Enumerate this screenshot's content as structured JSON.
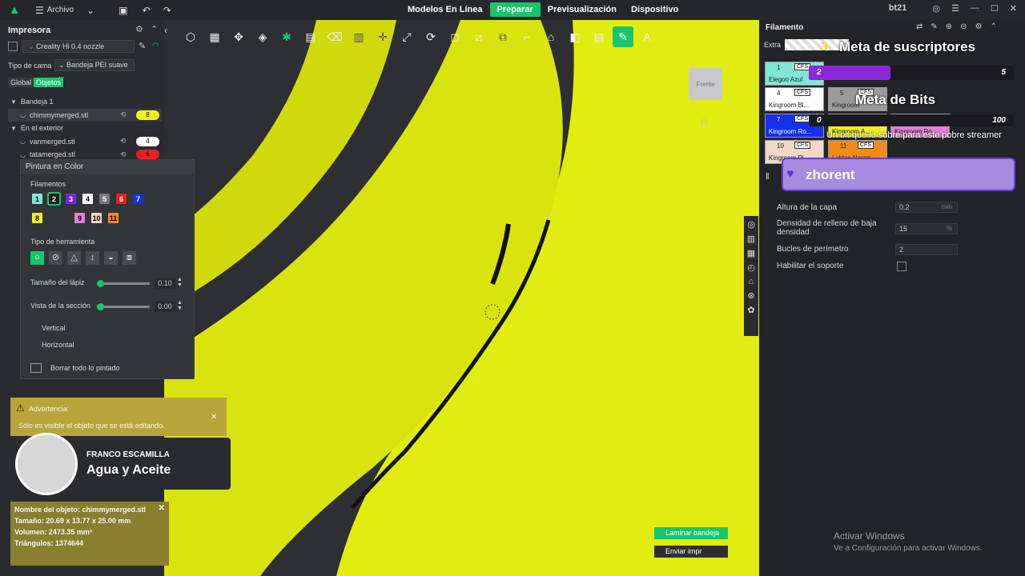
{
  "topbar": {
    "file_label": "Archivo",
    "tabs": [
      "Modelos En Línea",
      "Preparar",
      "Previsualización",
      "Dispositivo"
    ],
    "active_tab": "Preparar",
    "user": "bt21"
  },
  "left": {
    "printer_title": "Impresora",
    "printer_name": "Creality Hi 0.4 nozzle",
    "bed_label": "Tipo de cama",
    "bed_value": "Bandeja PEI suave ...",
    "mode_tabs": [
      "Global",
      "Objetos"
    ],
    "tree": [
      {
        "label": "Bandeja 1",
        "level": 0
      },
      {
        "label": "chimmymerged.stl",
        "level": 1,
        "badge": "8",
        "badge_color": "#f2f21a"
      },
      {
        "label": "En el exterior",
        "level": 0
      },
      {
        "label": "vanmerged.stl",
        "level": 1,
        "badge": "4",
        "badge_color": "#ffffff"
      },
      {
        "label": "tatamerged.stl",
        "level": 1,
        "badge": "6",
        "badge_color": "#e8201e"
      }
    ]
  },
  "paint": {
    "title": "Pintura en Color",
    "filaments_label": "Filamentos",
    "filaments": [
      {
        "n": "1",
        "color": "#7fe7d6"
      },
      {
        "n": "2",
        "color": "#1a1a1a"
      },
      {
        "n": "3",
        "color": "#7a24e0"
      },
      {
        "n": "4",
        "color": "#ffffff"
      },
      {
        "n": "5",
        "color": "#777777"
      },
      {
        "n": "6",
        "color": "#e8201e"
      },
      {
        "n": "7",
        "color": "#1430ea"
      },
      {
        "n": "8",
        "color": "#f2f21a"
      },
      {
        "n": "9",
        "color": "#e57fd8"
      },
      {
        "n": "10",
        "color": "#f0d9c8"
      },
      {
        "n": "11",
        "color": "#f08a18"
      }
    ],
    "tool_type_label": "Tipo de herramienta",
    "pen_size_label": "Tamaño del lápiz",
    "pen_size_value": "0.10",
    "section_label": "Vista de la sección",
    "section_value": "0.00",
    "vertical_label": "Vertical",
    "horizontal_label": "Horizontal",
    "clear_label": "Borrar todo lo pintado"
  },
  "warning": {
    "title": "Advertencia:",
    "text": "Sólo es visible el objeto que se está editando."
  },
  "now_playing": {
    "artist": "FRANCO ESCAMILLA",
    "title": "Agua y Aceite"
  },
  "object_info": {
    "name": "Nombre del objeto: chimmymerged.stl",
    "size": "Tamaño: 20.69 x 13.77 x 25.00 mm",
    "volume": "Volumen: 2473.35 mm³",
    "triangles": "Triángulos: 1374644"
  },
  "viewport": {
    "cube_label": "Frente",
    "slice_button": "Laminar bandeja",
    "send_button": "Enviar impr"
  },
  "right": {
    "filament_title": "Filamento",
    "extra_label": "Extra",
    "slots": [
      {
        "n": "1",
        "name": "Elegoo Azul",
        "color": "#7fe7d6"
      },
      {
        "n": "4",
        "name": "Kingroom Bl...",
        "color": "#ffffff"
      },
      {
        "n": "5",
        "name": "Kingroom",
        "color": "#9a9a9a"
      },
      {
        "n": "7",
        "name": "Kingroom Ro...",
        "color": "#1430ea"
      },
      {
        "n": "8",
        "name": "Kingroom A...",
        "color": "#f2f21a"
      },
      {
        "n": "9",
        "name": "Kingroom Ro...",
        "color": "#e57fd8"
      },
      {
        "n": "10",
        "name": "Kingroom Pl...",
        "color": "#f0d9c8"
      },
      {
        "n": "11",
        "name": "Luktec Naran...",
        "color": "#f08a18"
      }
    ],
    "cfs_label": "CFS",
    "sub_goal": "Meta de suscriptores",
    "sub_current": "2",
    "sub_target": "5",
    "bits_goal": "Meta de Bits",
    "bits_current": "0",
    "bits_target": "100",
    "bits_text": "Un bit que le sobre para este pobre streamer",
    "recent_user": "zhorent",
    "settings": [
      {
        "label": "Altura de la capa",
        "value": "0.2",
        "unit": "mm"
      },
      {
        "label": "Densidad de relleno de baja densidad",
        "value": "15",
        "unit": "%"
      },
      {
        "label": "Bucles de perímetro",
        "value": "2",
        "unit": ""
      },
      {
        "label": "Habilitar el soporte",
        "value": "",
        "unit": ""
      }
    ],
    "activate_title": "Activar Windows",
    "activate_text": "Ve a Configuración para activar Windows."
  },
  "colors": {
    "accent": "#19c56b",
    "model": "#e3ee12",
    "panel": "#2a2b2f"
  }
}
